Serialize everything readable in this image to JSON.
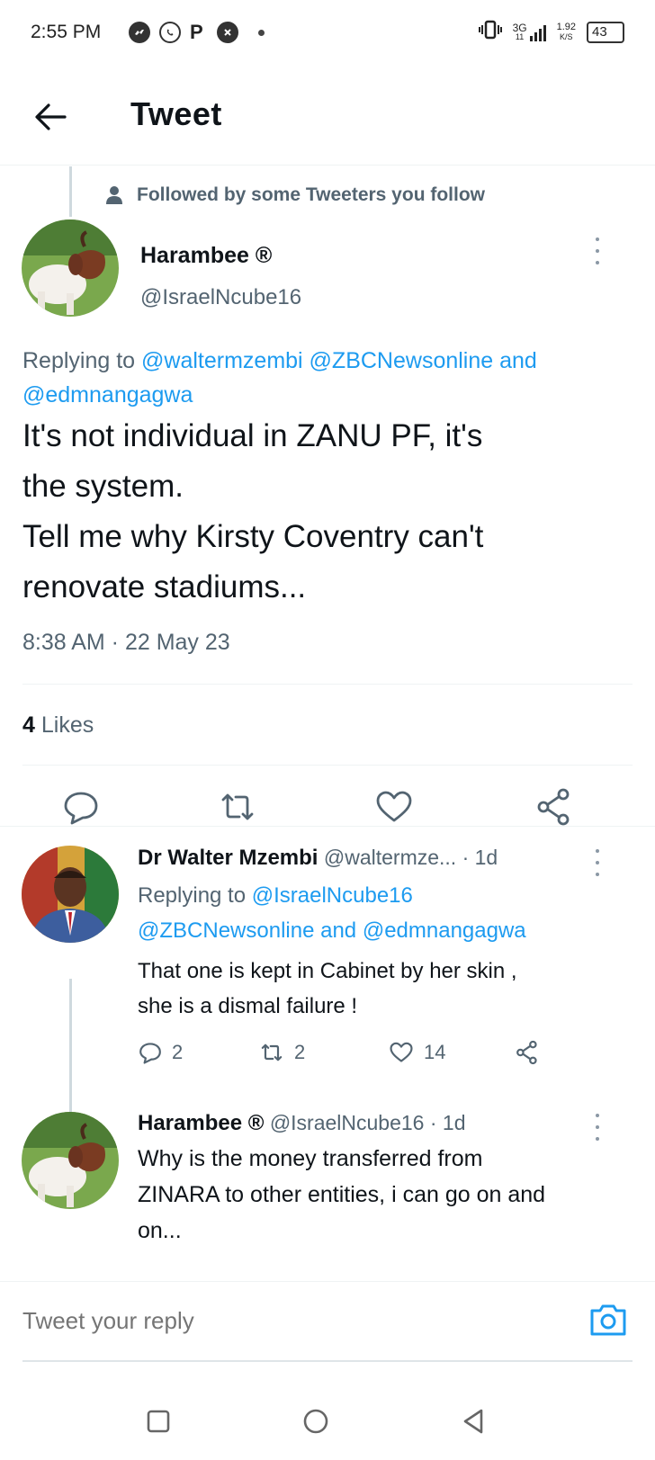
{
  "status_bar": {
    "time": "2:55 PM",
    "network": "3G",
    "sub_network": "11",
    "speed": "1.92",
    "speed_unit": "K/S",
    "battery": "43",
    "app_icon_p": "P"
  },
  "header": {
    "title": "Tweet"
  },
  "social_context": {
    "text": "Followed by some Tweeters you follow"
  },
  "main_tweet": {
    "display_name": "Harambee ®",
    "handle": "@IsraelNcube16",
    "replying_prefix": "Replying to",
    "replying_mentions_1": "@waltermzembi @ZBCNewsonline",
    "replying_and": "and",
    "replying_mentions_2": "@edmnangagwa",
    "text_line_1": "It's not individual in ZANU PF, it's",
    "text_line_2": "the system.",
    "text_line_3": "Tell me why Kirsty Coventry can't",
    "text_line_4": "renovate stadiums...",
    "timestamp": "8:38 AM · 22 May 23",
    "likes_count": "4",
    "likes_label": "Likes"
  },
  "replies": [
    {
      "display_name": "Dr Walter Mzembi",
      "handle_time": "@waltermze... · 1d",
      "replying_prefix": "Replying to",
      "replying_mention_1": "@IsraelNcube16",
      "replying_mention_2": "@ZBCNewsonline",
      "replying_and": "and",
      "replying_mention_3": "@edmnangagwa",
      "text_line_1": "That one is kept in Cabinet by her skin ,",
      "text_line_2": "she is a dismal failure !",
      "reply_count": "2",
      "retweet_count": "2",
      "like_count": "14"
    },
    {
      "display_name": "Harambee ®",
      "handle_time": "@IsraelNcube16 · 1d",
      "text_line_1": "Why is the money transferred from",
      "text_line_2": "ZINARA to other entities, i can go on and",
      "text_line_3": "on..."
    }
  ],
  "composer": {
    "placeholder": "Tweet your reply"
  },
  "icons": {
    "back": "arrow-left-icon",
    "reply": "speech-bubble-icon",
    "retweet": "retweet-icon",
    "like": "heart-icon",
    "share": "share-icon",
    "camera": "camera-icon",
    "more": "vertical-dots-icon",
    "person": "person-icon"
  },
  "colors": {
    "link": "#1d9bf0",
    "muted": "#536471",
    "text": "#0f1419",
    "divider": "#eff3f4"
  }
}
